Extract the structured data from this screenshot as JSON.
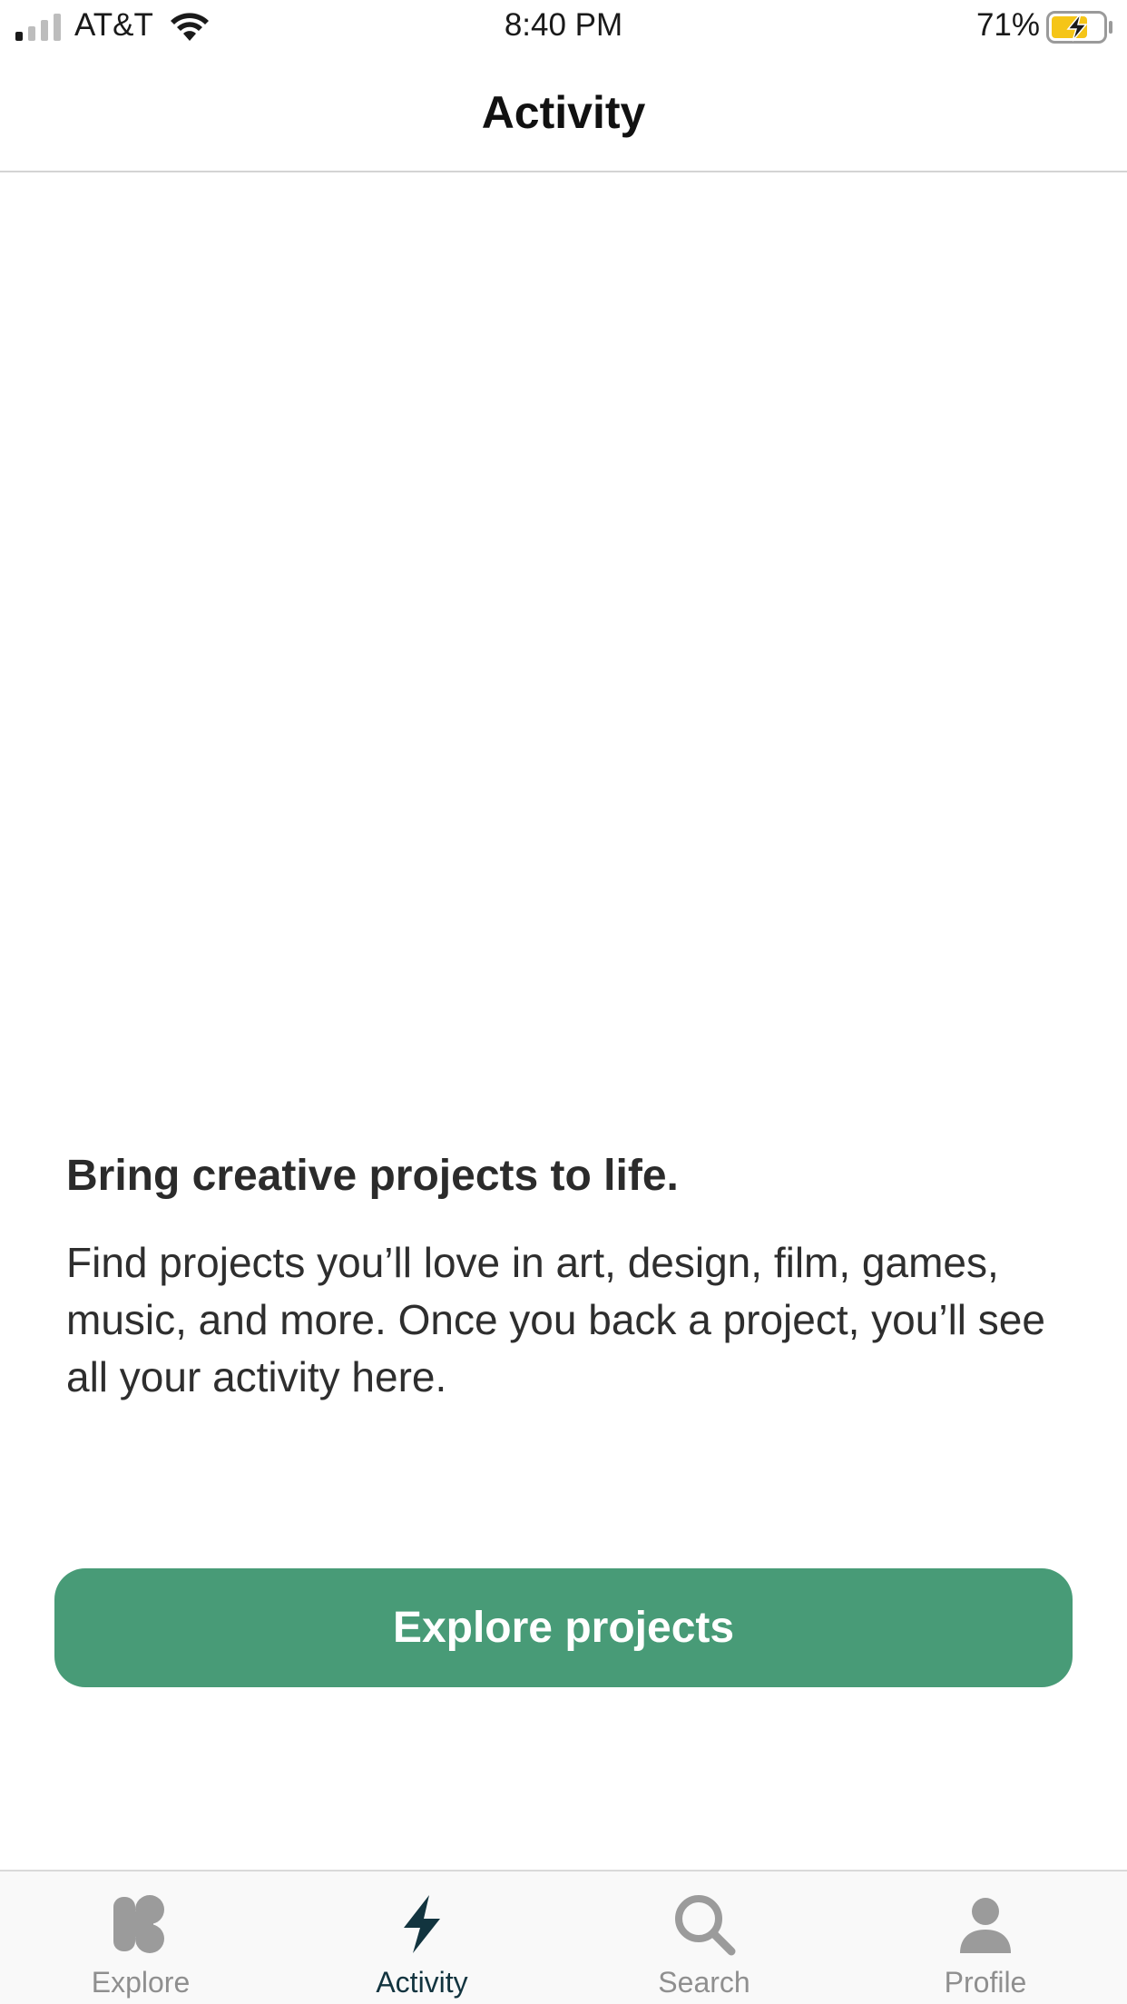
{
  "status_bar": {
    "carrier": "AT&T",
    "time": "8:40 PM",
    "battery_percent": "71%",
    "battery_level": 0.71,
    "charging": true,
    "signal_bars": 1
  },
  "nav": {
    "title": "Activity"
  },
  "empty_state": {
    "title": "Bring creative projects to life.",
    "body": "Find projects you’ll love in art, design, film, games, music, and more. Once you back a project, you’ll see all your activity here.",
    "button_label": "Explore projects"
  },
  "tab_bar": {
    "tabs": [
      {
        "label": "Explore",
        "icon": "kickstarter-k-icon",
        "active": false
      },
      {
        "label": "Activity",
        "icon": "lightning-bolt-icon",
        "active": true
      },
      {
        "label": "Search",
        "icon": "magnifier-icon",
        "active": false
      },
      {
        "label": "Profile",
        "icon": "person-icon",
        "active": false
      }
    ]
  },
  "colors": {
    "accent_green": "#489b77",
    "active_tab": "#12343f",
    "inactive_tab": "#8f8f8f",
    "battery_charging": "#f5c518"
  }
}
